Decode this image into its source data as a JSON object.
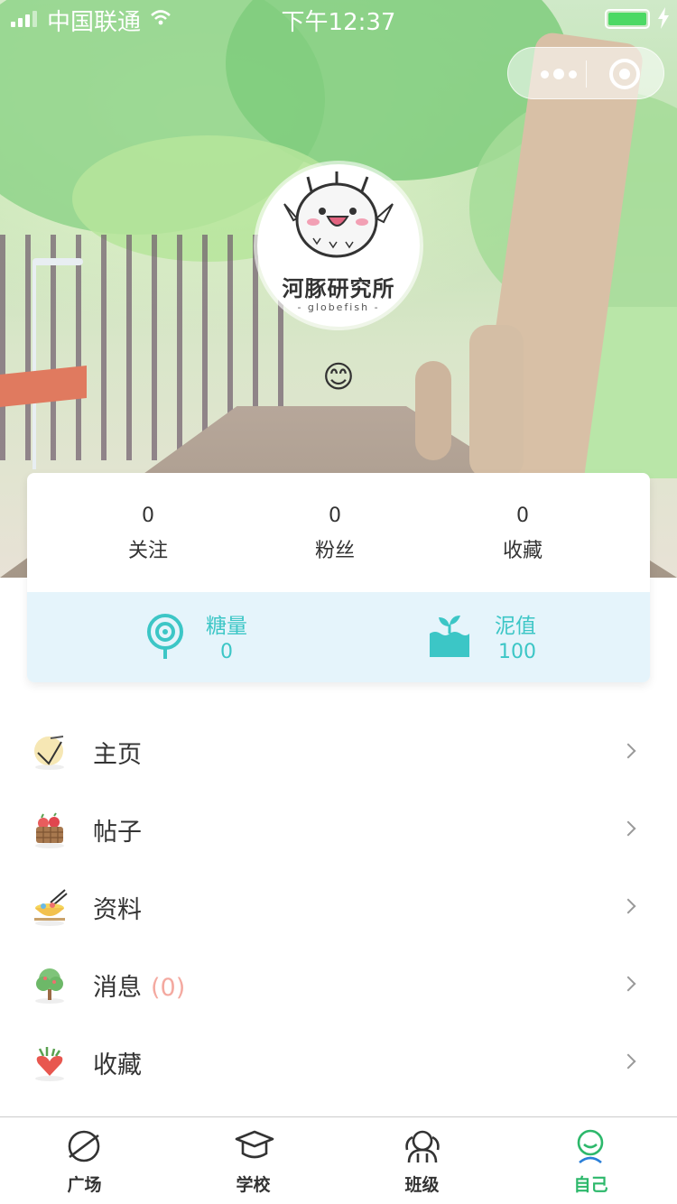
{
  "status_bar": {
    "carrier": "中国联通",
    "time": "下午12:37",
    "battery_percent": 100
  },
  "capsule": {
    "more_icon": "more-dots-icon",
    "close_icon": "target-close-icon"
  },
  "profile": {
    "avatar_text": "河豚研究所",
    "avatar_sub": "- globefish -",
    "status_emoji": "😊"
  },
  "stats": [
    {
      "value": "0",
      "label": "关注"
    },
    {
      "value": "0",
      "label": "粉丝"
    },
    {
      "value": "0",
      "label": "收藏"
    }
  ],
  "metrics": [
    {
      "label": "糖量",
      "value": "0",
      "icon": "lollipop-icon"
    },
    {
      "label": "泥值",
      "value": "100",
      "icon": "sprout-pot-icon"
    }
  ],
  "menu": [
    {
      "label": "主页",
      "count": "",
      "icon": "rice-ball-icon"
    },
    {
      "label": "帖子",
      "count": "",
      "icon": "basket-icon"
    },
    {
      "label": "资料",
      "count": "",
      "icon": "noodle-bowl-icon"
    },
    {
      "label": "消息",
      "count": "(0)",
      "icon": "tree-icon"
    },
    {
      "label": "收藏",
      "count": "",
      "icon": "carrot-heart-icon"
    }
  ],
  "tabbar": [
    {
      "label": "广场",
      "icon": "planet-icon",
      "active": false
    },
    {
      "label": "学校",
      "icon": "graduation-cap-icon",
      "active": false
    },
    {
      "label": "班级",
      "icon": "group-icon",
      "active": false
    },
    {
      "label": "自己",
      "icon": "smile-person-icon",
      "active": true
    }
  ],
  "colors": {
    "accent": "#3cc6c6",
    "tab_active": "#2db86b",
    "metrics_bg": "#e5f4fb",
    "message_count": "#f4a9a0"
  }
}
